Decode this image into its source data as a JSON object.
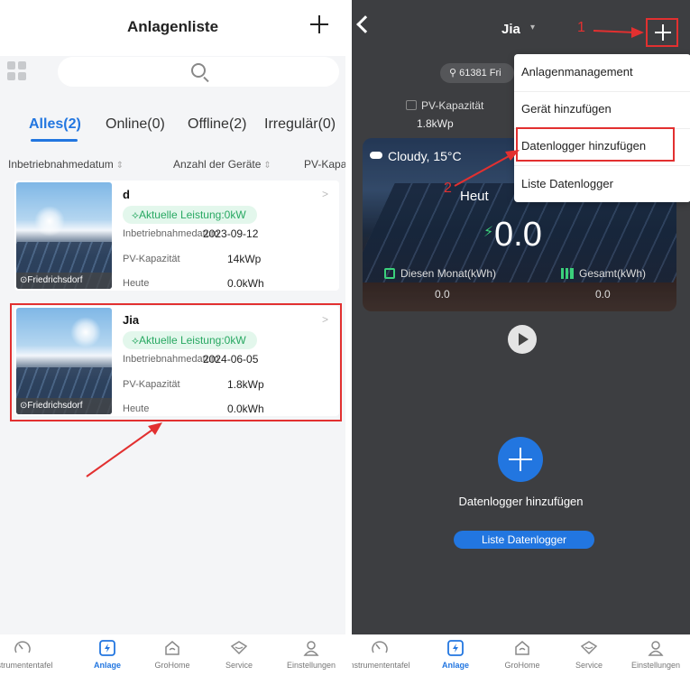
{
  "left": {
    "title": "Anlagenliste",
    "tabs": [
      {
        "label": "Alles(2)"
      },
      {
        "label": "Online(0)"
      },
      {
        "label": "Offline(2)"
      },
      {
        "label": "Irregulär(0)"
      }
    ],
    "sort": [
      {
        "label": "Inbetriebnahmedatum"
      },
      {
        "label": "Anzahl der Geräte"
      },
      {
        "label": "PV-Kapa"
      }
    ],
    "plants": [
      {
        "name": "d",
        "power": "Aktuelle Leistung:0kW",
        "date_label": "Inbetriebnahmedatum",
        "date": "2023-09-12",
        "capacity_label": "PV-Kapazität",
        "capacity": "14kWp",
        "today_label": "Heute",
        "today": "0.0kWh",
        "location": "Friedrichsdorf"
      },
      {
        "name": "Jia",
        "power": "Aktuelle Leistung:0kW",
        "date_label": "Inbetriebnahmedatum",
        "date": "2024-06-05",
        "capacity_label": "PV-Kapazität",
        "capacity": "1.8kWp",
        "today_label": "Heute",
        "today": "0.0kWh",
        "location": "Friedrichsdorf"
      }
    ]
  },
  "nav": [
    {
      "label": "nstrumententafel",
      "icon": "dashboard-icon"
    },
    {
      "label": "Anlage",
      "icon": "plant-icon",
      "active": true
    },
    {
      "label": "GroHome",
      "icon": "home-icon"
    },
    {
      "label": "Service",
      "icon": "service-icon"
    },
    {
      "label": "Einstellungen",
      "icon": "user-icon"
    }
  ],
  "right": {
    "plant_name": "Jia",
    "step1": "1",
    "step2": "2",
    "address": "61381 Fri",
    "capacity_label": "PV-Kapazität",
    "capacity_value": "1.8kWp",
    "weather": "Cloudy, 15°C",
    "heute_label": "Heut",
    "power_value": "0.0",
    "month_label": "Diesen Monat(kWh)",
    "month_value": "0.0",
    "total_label": "Gesamt(kWh)",
    "total_value": "0.0",
    "add_text": "Datenlogger hinzufügen",
    "liste_button": "Liste Datenlogger",
    "menu": [
      {
        "label": "Anlagenmanagement"
      },
      {
        "label": "Gerät hinzufügen"
      },
      {
        "label": "Datenlogger hinzufügen"
      },
      {
        "label": "Liste Datenlogger"
      }
    ]
  },
  "colors": {
    "accent": "#2276e0",
    "highlight": "#e23030",
    "power_green": "#28a862"
  }
}
